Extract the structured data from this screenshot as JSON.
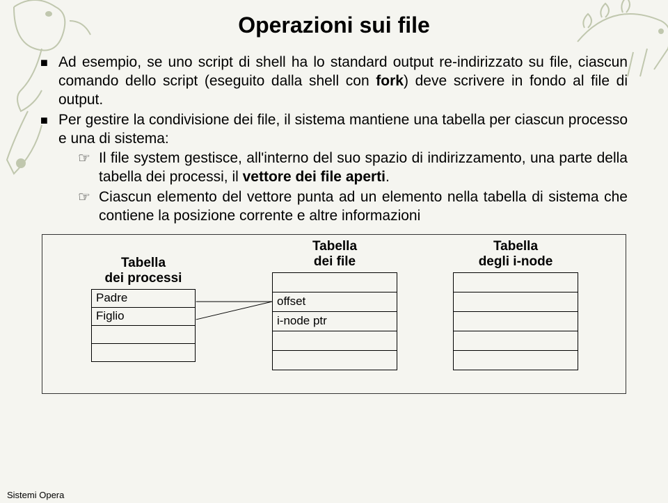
{
  "title": "Operazioni sui file",
  "bullets": [
    {
      "text_parts": [
        "Ad esempio, se uno script di shell ha lo standard output re-indirizzato su file, ciascun comando dello script (eseguito dalla shell con ",
        "fork",
        ") deve scrivere in fondo al file di output."
      ],
      "bold_index": 1
    },
    {
      "text_plain": "Per gestire la condivisione dei file, il sistema mantiene una tabella per ciascun processo e una di sistema:",
      "subs": [
        {
          "text_parts": [
            "Il file system gestisce, all'interno del suo spazio di indirizzamento, una parte della tabella dei processi, il ",
            "vettore dei file aperti",
            "."
          ],
          "bold_index": 1
        },
        {
          "text_plain": "Ciascun elemento del vettore punta ad un elemento nella tabella di sistema che contiene la posizione corrente e altre informazioni"
        }
      ]
    }
  ],
  "diagram": {
    "process_table_label": "Tabella\ndei processi",
    "process_rows": [
      "Padre",
      "Figlio",
      "",
      ""
    ],
    "file_table_label": "Tabella\ndei file",
    "file_rows": [
      "",
      "offset",
      "i-node ptr",
      "",
      ""
    ],
    "inode_table_label": "Tabella\ndegli i-node",
    "inode_rows": [
      "",
      "",
      "",
      "",
      ""
    ]
  },
  "footer": "Sistemi Opera"
}
